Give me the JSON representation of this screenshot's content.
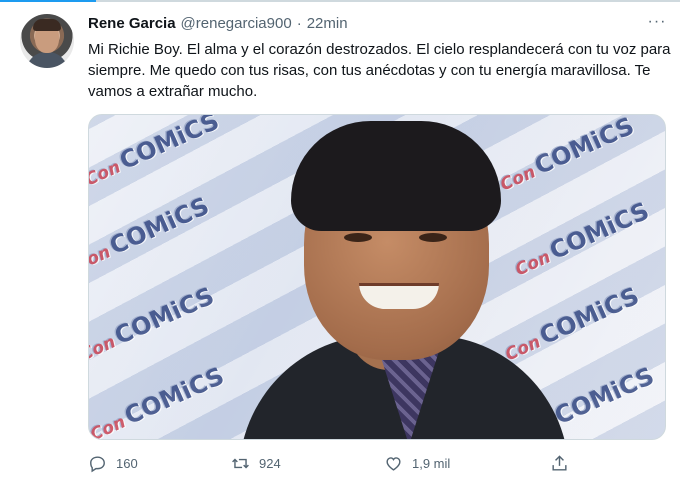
{
  "tweet": {
    "author_name": "Rene Garcia",
    "author_handle": "@renegarcia900",
    "separator": "·",
    "timestamp": "22min",
    "more_label": "···",
    "text": "Mi Richie Boy. El alma y el corazón destrozados. El cielo resplandecerá con tu voz para siempre. Me quedo con tus risas, con tus anécdotas y con tu energía maravillosa. Te vamos a extrañar mucho.",
    "media": {
      "backdrop_logo_prefix": "Con",
      "backdrop_logo_word": "COMiCS"
    },
    "actions": {
      "reply_count": "160",
      "retweet_count": "924",
      "like_count": "1,9 mil"
    }
  },
  "colors": {
    "accent": "#1d9bf0",
    "text": "#0f1419",
    "muted": "#536471"
  },
  "icons": [
    "reply-icon",
    "retweet-icon",
    "like-icon",
    "share-icon",
    "more-icon"
  ]
}
